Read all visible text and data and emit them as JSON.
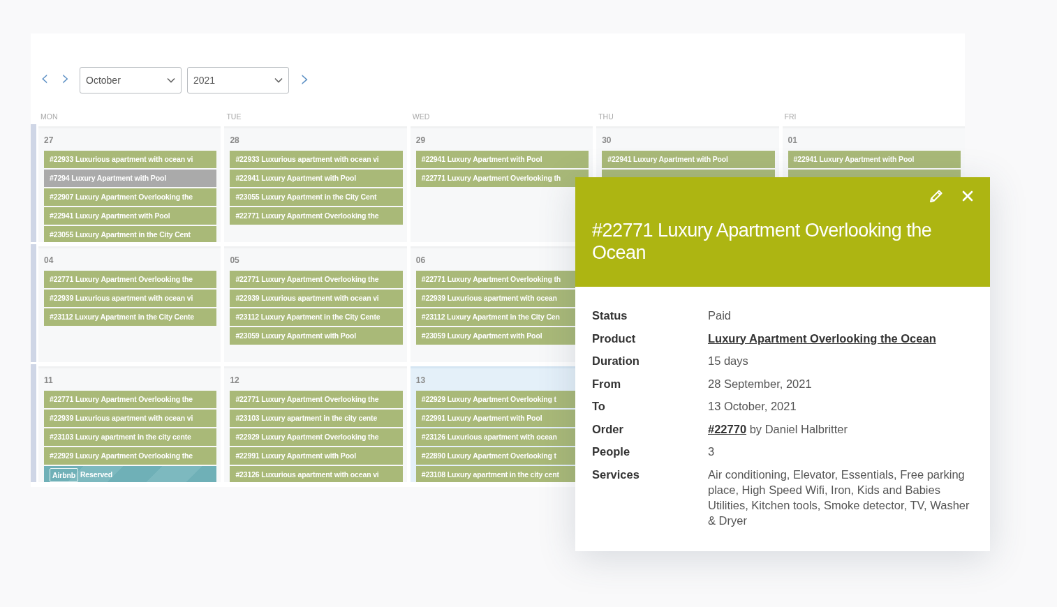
{
  "toolbar": {
    "prev_label": "‹",
    "next_label": "›",
    "month": "October",
    "year": "2021",
    "forward_label": "›"
  },
  "weekdays": [
    "MON",
    "TUE",
    "WED",
    "THU",
    "FRI"
  ],
  "weeks": [
    {
      "days": [
        {
          "number": "27",
          "today": false,
          "events": [
            {
              "kind": "booking",
              "text": "#22933 Luxurious apartment with ocean vi"
            },
            {
              "kind": "blocked",
              "text": "#7294 Luxury Apartment with Pool"
            },
            {
              "kind": "booking",
              "text": "#22907 Luxury Apartment Overlooking the"
            },
            {
              "kind": "booking",
              "text": "#22941 Luxury Apartment with Pool"
            },
            {
              "kind": "booking",
              "text": "#23055 Luxury Apartment in the City Cent"
            }
          ]
        },
        {
          "number": "28",
          "today": false,
          "events": [
            {
              "kind": "booking",
              "text": "#22933 Luxurious apartment with ocean vi"
            },
            {
              "kind": "booking",
              "text": "#22941 Luxury Apartment with Pool"
            },
            {
              "kind": "booking",
              "text": "#23055 Luxury Apartment in the City Cent"
            },
            {
              "kind": "booking",
              "text": "#22771 Luxury Apartment Overlooking the"
            }
          ]
        },
        {
          "number": "29",
          "today": false,
          "events": [
            {
              "kind": "booking",
              "text": "#22941 Luxury Apartment with Pool"
            },
            {
              "kind": "booking",
              "text": "#22771 Luxury Apartment Overlooking th"
            }
          ]
        },
        {
          "number": "30",
          "today": false,
          "events": [
            {
              "kind": "booking",
              "text": "#22941 Luxury Apartment with Pool"
            },
            {
              "kind": "booking"
            }
          ]
        },
        {
          "number": "01",
          "today": false,
          "events": [
            {
              "kind": "booking",
              "text": "#22941 Luxury Apartment with Pool"
            },
            {
              "kind": "booking"
            }
          ]
        }
      ]
    },
    {
      "days": [
        {
          "number": "04",
          "today": false,
          "events": [
            {
              "kind": "booking",
              "text": "#22771 Luxury Apartment Overlooking the"
            },
            {
              "kind": "booking",
              "text": "#22939 Luxurious apartment with ocean vi"
            },
            {
              "kind": "booking",
              "text": "#23112 Luxury Apartment in the City Cente"
            }
          ]
        },
        {
          "number": "05",
          "today": false,
          "events": [
            {
              "kind": "booking",
              "text": "#22771 Luxury Apartment Overlooking the"
            },
            {
              "kind": "booking",
              "text": "#22939 Luxurious apartment with ocean vi"
            },
            {
              "kind": "booking",
              "text": "#23112 Luxury Apartment in the City Cente"
            },
            {
              "kind": "booking",
              "text": "#23059 Luxury Apartment with Pool"
            }
          ]
        },
        {
          "number": "06",
          "today": false,
          "events": [
            {
              "kind": "booking",
              "text": "#22771 Luxury Apartment Overlooking th"
            },
            {
              "kind": "booking",
              "text": "#22939 Luxurious apartment with ocean"
            },
            {
              "kind": "booking",
              "text": "#23112 Luxury Apartment in the City Cen"
            },
            {
              "kind": "booking",
              "text": "#23059 Luxury Apartment with Pool"
            }
          ]
        }
      ]
    },
    {
      "days": [
        {
          "number": "11",
          "today": false,
          "events": [
            {
              "kind": "booking",
              "text": "#22771 Luxury Apartment Overlooking the"
            },
            {
              "kind": "booking",
              "text": "#22939 Luxurious apartment with ocean vi"
            },
            {
              "kind": "booking",
              "text": "#23103 Luxury apartment in the city cente"
            },
            {
              "kind": "booking",
              "text": "#22929 Luxury Apartment Overlooking the"
            },
            {
              "kind": "airbnb",
              "badge": "Airbnb",
              "text": "Reserved"
            }
          ]
        },
        {
          "number": "12",
          "today": false,
          "events": [
            {
              "kind": "booking",
              "text": "#22771 Luxury Apartment Overlooking the"
            },
            {
              "kind": "booking",
              "text": "#23103 Luxury apartment in the city cente"
            },
            {
              "kind": "booking",
              "text": "#22929 Luxury Apartment Overlooking the"
            },
            {
              "kind": "booking",
              "text": "#22991 Luxury Apartment with Pool"
            },
            {
              "kind": "booking",
              "text": "#23126 Luxurious apartment with ocean vi"
            }
          ]
        },
        {
          "number": "13",
          "today": true,
          "events": [
            {
              "kind": "booking",
              "text": "#22929 Luxury Apartment Overlooking t"
            },
            {
              "kind": "booking",
              "text": "#22991 Luxury Apartment with Pool"
            },
            {
              "kind": "booking",
              "text": "#23126 Luxurious apartment with ocean"
            },
            {
              "kind": "booking",
              "text": "#22890 Luxury Apartment Overlooking t"
            },
            {
              "kind": "booking",
              "text": "#23108 Luxury apartment in the city cent"
            }
          ]
        }
      ]
    }
  ],
  "popup": {
    "title": "#22771 Luxury Apartment Overlooking the Ocean",
    "details": [
      {
        "kind": "text",
        "label": "Status",
        "value": "Paid"
      },
      {
        "kind": "link",
        "label": "Product",
        "value": "Luxury Apartment Overlooking the Ocean"
      },
      {
        "kind": "text",
        "label": "Duration",
        "value": "15 days"
      },
      {
        "kind": "text",
        "label": "From",
        "value": "28 September, 2021"
      },
      {
        "kind": "text",
        "label": "To",
        "value": "13 October, 2021"
      },
      {
        "kind": "link_text",
        "label": "Order",
        "link": "#22770",
        "value": "by Daniel Halbritter"
      },
      {
        "kind": "text",
        "label": "People",
        "value": "3"
      },
      {
        "kind": "text",
        "label": "Services",
        "value": "Air conditioning, Elevator, Essentials, Free parking place, High Speed Wifi, Iron, Kids and Babies Utilities, Kitchen tools, Smoke detector, TV, Washer & Dryer"
      }
    ]
  }
}
